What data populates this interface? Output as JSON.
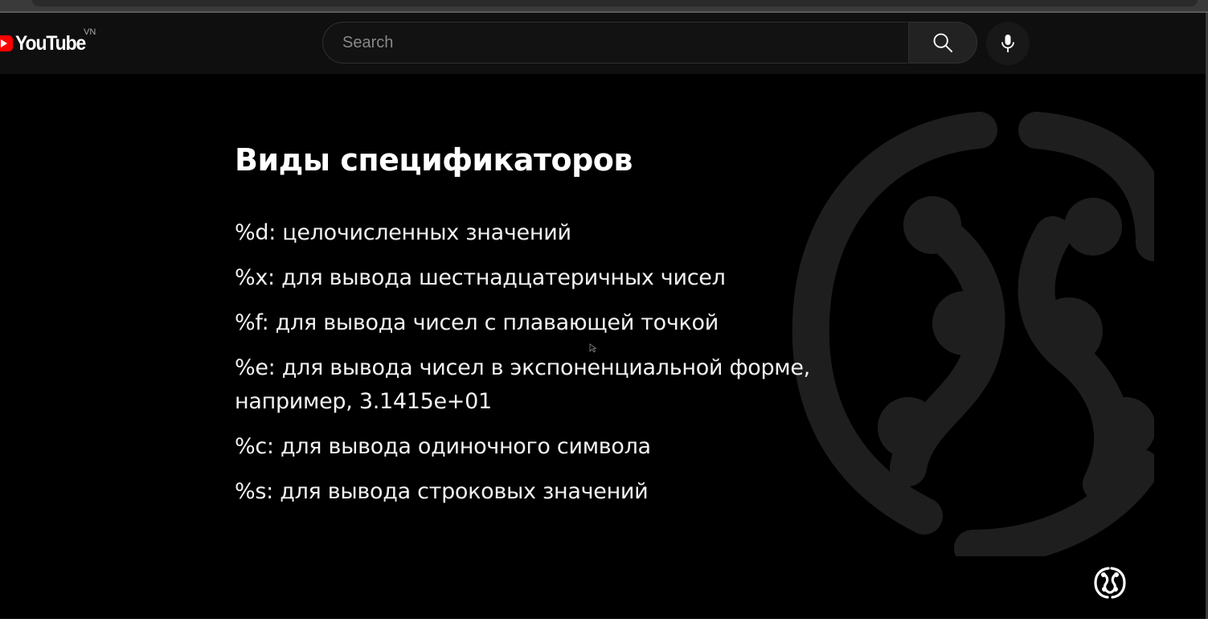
{
  "browser": {},
  "header": {
    "logo_text": "YouTube",
    "country_code": "VN",
    "search_placeholder": "Search"
  },
  "video": {
    "slide": {
      "title": "Виды спецификаторов",
      "items": [
        "%d: целочисленных значений",
        "%x: для вывода шестнадцатеричных чисел",
        "%f: для вывода чисел с плавающей точкой",
        "%e: для вывода чисел в экспоненциальной форме,",
        "например, 3.1415e+01",
        "%c: для вывода одиночного символа",
        "%s: для вывода строковых значений"
      ]
    },
    "watermark_icon": "brain-logo-icon"
  },
  "colors": {
    "masthead_bg": "#0f0f0f",
    "video_bg": "#000000",
    "brand_red": "#ff0000",
    "watermark": "#1e1e1e"
  }
}
